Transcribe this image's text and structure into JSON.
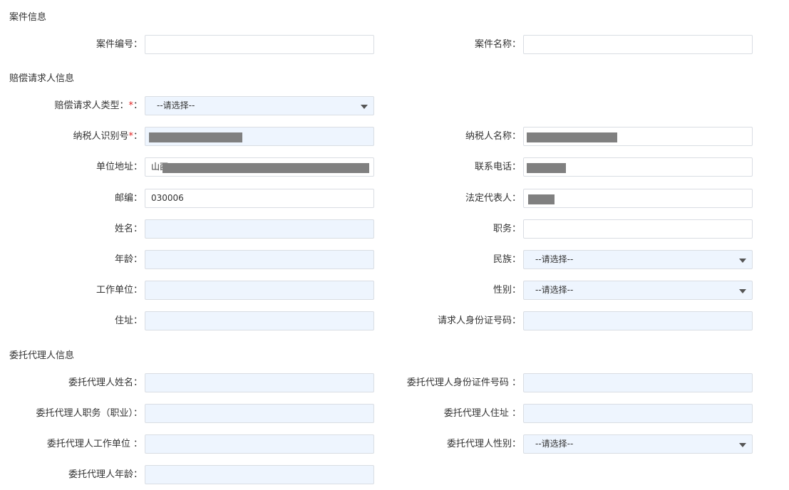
{
  "case_section": {
    "title": "案件信息",
    "case_number_label": "案件编号：",
    "case_name_label": "案件名称："
  },
  "claimant_section": {
    "title": "赔偿请求人信息",
    "type_label": "赔偿请求人类型：",
    "type_required_mark": "*",
    "type_suffix": "：",
    "type_value": "--请选择--",
    "taxpayer_id_label": "纳税人识别号",
    "taxpayer_id_required_mark": "*",
    "taxpayer_id_suffix": "：",
    "taxpayer_name_label": "纳税人名称：",
    "address_label": "单位地址：",
    "address_value_prefix": "山西",
    "phone_label": "联系电话：",
    "postcode_label": "邮编：",
    "postcode_value": "030006",
    "legal_rep_label": "法定代表人：",
    "name_label": "姓名：",
    "position_label": "职务：",
    "age_label": "年龄：",
    "ethnicity_label": "民族：",
    "ethnicity_value": "--请选择--",
    "employer_label": "工作单位：",
    "gender_label": "性别：",
    "gender_value": "--请选择--",
    "residence_label": "住址：",
    "id_number_label": "请求人身份证号码："
  },
  "agent_section": {
    "title": "委托代理人信息",
    "name_label": "委托代理人姓名：",
    "id_label": "委托代理人身份证件号码 ：",
    "job_label": "委托代理人职务（职业）：",
    "address_label": "委托代理人住址 ：",
    "employer_label": "委托代理人工作单位 ：",
    "gender_label": "委托代理人性别：",
    "gender_value": "--请选择--",
    "age_label": "委托代理人年龄："
  },
  "icons": {
    "dropdown": "chevron-down-icon",
    "redaction": "redacted-block"
  },
  "colors": {
    "text": "#333333",
    "required": "#e02020",
    "field_border": "#d9dde3",
    "field_tint": "#eef5fe",
    "redaction": "#808080"
  }
}
